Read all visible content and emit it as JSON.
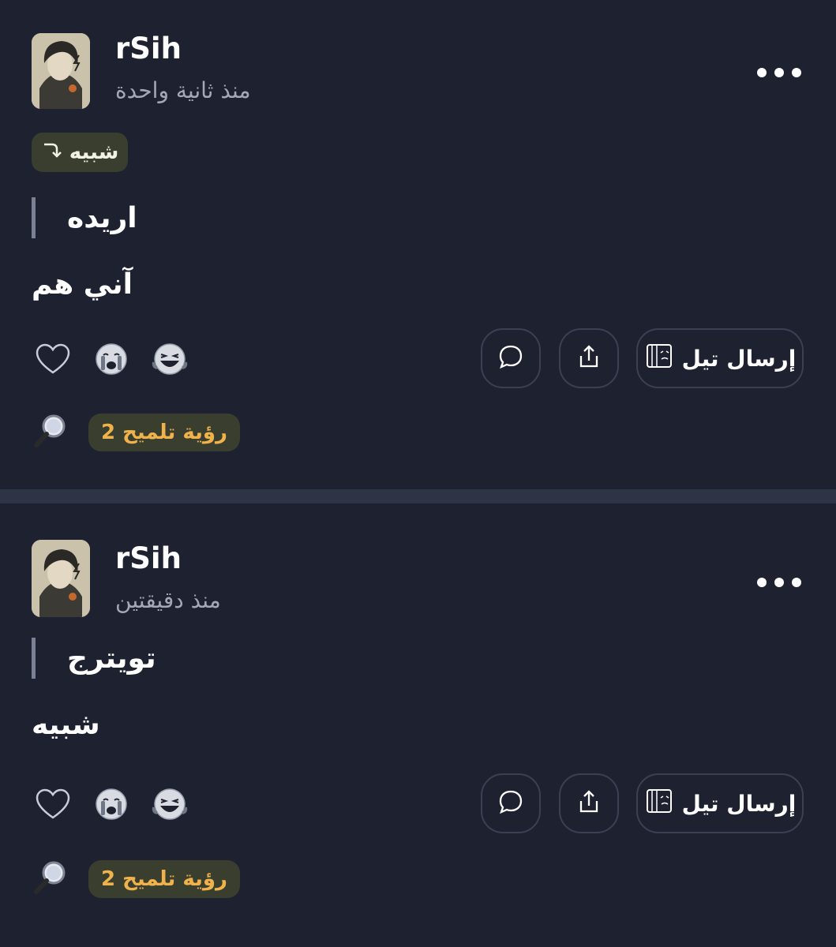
{
  "posts": [
    {
      "username": "rSih",
      "time": "منذ ثانية واحدة",
      "reply_chip": "شبيه",
      "quote": "اريده",
      "body": "آني هم",
      "send_label": "إرسال تيل",
      "hint_label": "رؤية تلميح 2"
    },
    {
      "username": "rSih",
      "time": "منذ دقيقتين",
      "quote": "تويترج",
      "body": "شبيه",
      "send_label": "إرسال تيل",
      "hint_label": "رؤية تلميح 2"
    }
  ],
  "colors": {
    "background": "#1e2130",
    "divider": "#2d3446",
    "chip_bg": "#3a3e2f",
    "hint_text": "#f0b24a",
    "muted_text": "#a3a8b8"
  },
  "icons": [
    "heart-icon",
    "crying-face-icon",
    "laughing-face-icon",
    "comment-icon",
    "share-icon",
    "tell-icon",
    "magnifier-icon",
    "more-icon",
    "reply-arrow-icon"
  ]
}
